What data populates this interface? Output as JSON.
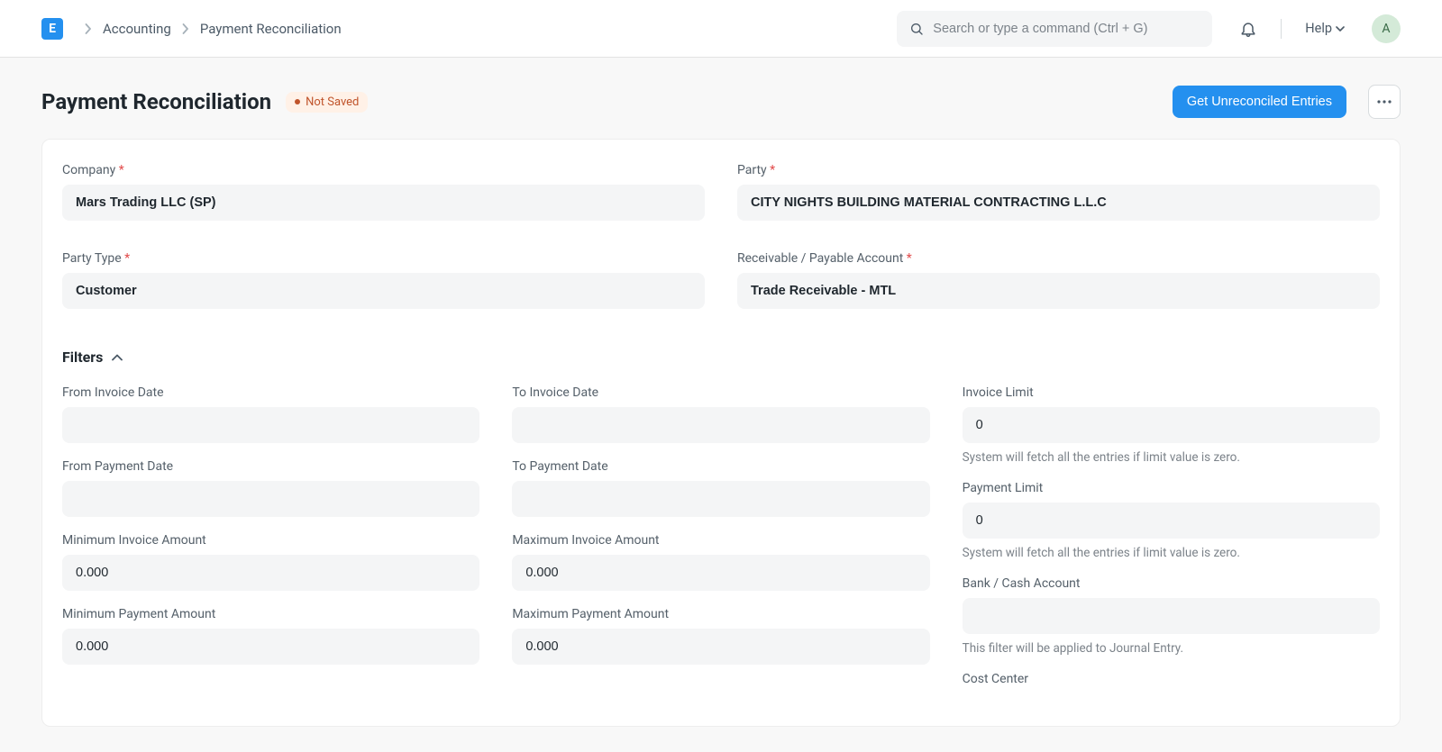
{
  "navbar": {
    "logo_letter": "E",
    "breadcrumb": {
      "parent": "Accounting",
      "current": "Payment Reconciliation"
    },
    "search_placeholder": "Search or type a command (Ctrl + G)",
    "help_label": "Help",
    "avatar_letter": "A"
  },
  "header": {
    "title": "Payment Reconciliation",
    "status": "Not Saved",
    "primary_button": "Get Unreconciled Entries"
  },
  "form": {
    "company": {
      "label": "Company",
      "value": "Mars Trading LLC (SP)"
    },
    "party": {
      "label": "Party",
      "value": "CITY NIGHTS BUILDING MATERIAL CONTRACTING L.L.C"
    },
    "party_type": {
      "label": "Party Type",
      "value": "Customer"
    },
    "account": {
      "label": "Receivable / Payable Account",
      "value": "Trade Receivable - MTL"
    }
  },
  "filters": {
    "section_label": "Filters",
    "from_invoice_date": {
      "label": "From Invoice Date",
      "value": ""
    },
    "to_invoice_date": {
      "label": "To Invoice Date",
      "value": ""
    },
    "from_payment_date": {
      "label": "From Payment Date",
      "value": ""
    },
    "to_payment_date": {
      "label": "To Payment Date",
      "value": ""
    },
    "min_invoice_amount": {
      "label": "Minimum Invoice Amount",
      "value": "0.000"
    },
    "max_invoice_amount": {
      "label": "Maximum Invoice Amount",
      "value": "0.000"
    },
    "min_payment_amount": {
      "label": "Minimum Payment Amount",
      "value": "0.000"
    },
    "max_payment_amount": {
      "label": "Maximum Payment Amount",
      "value": "0.000"
    },
    "invoice_limit": {
      "label": "Invoice Limit",
      "value": "0",
      "help": "System will fetch all the entries if limit value is zero."
    },
    "payment_limit": {
      "label": "Payment Limit",
      "value": "0",
      "help": "System will fetch all the entries if limit value is zero."
    },
    "bank_cash": {
      "label": "Bank / Cash Account",
      "value": "",
      "help": "This filter will be applied to Journal Entry."
    },
    "cost_center": {
      "label": "Cost Center",
      "value": ""
    }
  }
}
